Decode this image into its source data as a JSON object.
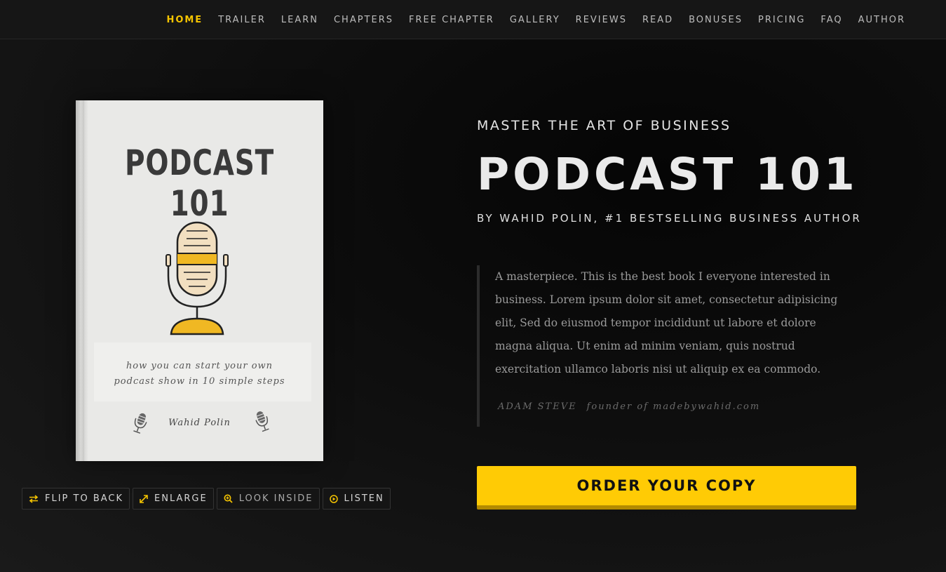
{
  "nav": {
    "items": [
      "HOME",
      "TRAILER",
      "LEARN",
      "CHAPTERS",
      "FREE CHAPTER",
      "GALLERY",
      "REVIEWS",
      "READ",
      "BONUSES",
      "PRICING",
      "FAQ",
      "AUTHOR"
    ],
    "active_index": 0
  },
  "book": {
    "title": "PODCAST 101",
    "subtitle": "how you can start your own\npodcast show in 10 simple steps",
    "author": "Wahid Polin"
  },
  "actions": {
    "flip": "FLIP TO BACK",
    "enlarge": "ENLARGE",
    "look_inside": "LOOK INSIDE",
    "listen": "LISTEN"
  },
  "hero": {
    "kicker": "MASTER THE ART OF BUSINESS",
    "title": "PODCAST 101",
    "byline": "BY WAHID POLIN, #1 BESTSELLING BUSINESS AUTHOR"
  },
  "quote": {
    "text": "A masterpiece. This is the best book I everyone interested in business. Lorem ipsum dolor sit amet, consectetur adipisicing elit, Sed do eiusmod tempor incididunt ut labore et dolore magna aliqua. Ut enim ad minim veniam, quis nostrud exercitation ullamco laboris nisi ut aliquip ex ea commodo.",
    "name": "ADAM STEVE",
    "role": "founder of madebywahid.com"
  },
  "cta": {
    "label": "ORDER YOUR COPY"
  },
  "colors": {
    "accent": "#ffcb05",
    "background": "#121212",
    "nav_bg": "#161616"
  },
  "icons": [
    "flip-icon",
    "expand-icon",
    "zoom-icon",
    "play-circle-icon",
    "microphone-icon"
  ]
}
